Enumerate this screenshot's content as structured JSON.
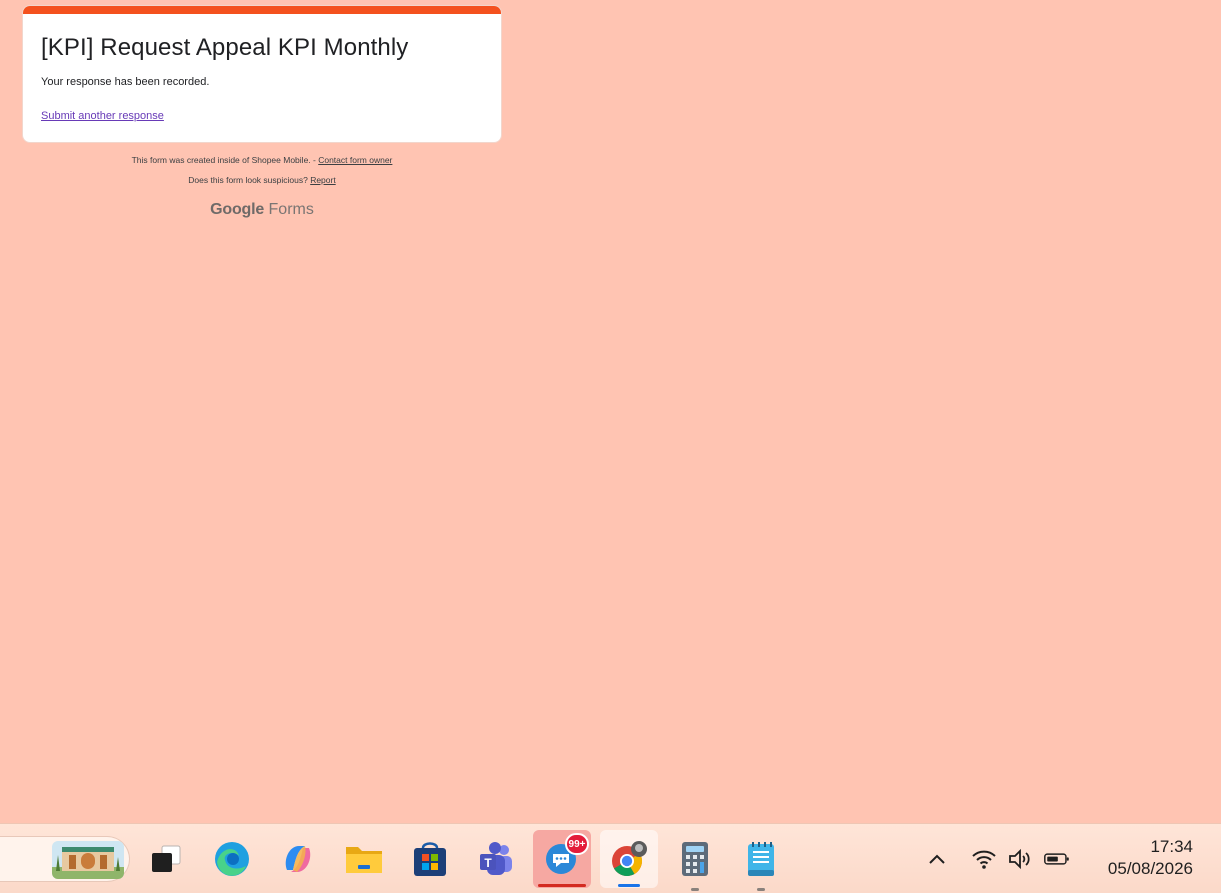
{
  "form": {
    "title": "[KPI] Request Appeal KPI Monthly",
    "confirmation": "Your response has been recorded.",
    "submit_another": "Submit another response",
    "accent_color": "#f4511e"
  },
  "footer": {
    "created_text": "This form was created inside of Shopee Mobile. - ",
    "contact_link": "Contact form owner",
    "suspicious_text": "Does this form look suspicious? ",
    "report_link": "Report",
    "logo_google": "Google",
    "logo_forms": "Forms"
  },
  "taskbar": {
    "apps": [
      {
        "name": "task-view",
        "icon": "task-view-icon"
      },
      {
        "name": "edge",
        "icon": "edge-icon"
      },
      {
        "name": "copilot",
        "icon": "copilot-icon"
      },
      {
        "name": "file-explorer",
        "icon": "folder-icon"
      },
      {
        "name": "microsoft-store",
        "icon": "store-icon"
      },
      {
        "name": "teams",
        "icon": "teams-icon"
      },
      {
        "name": "messenger",
        "icon": "chat-icon",
        "badge": "99+"
      },
      {
        "name": "chrome",
        "icon": "chrome-icon"
      },
      {
        "name": "calculator",
        "icon": "calculator-icon"
      },
      {
        "name": "notepad",
        "icon": "notepad-icon"
      }
    ],
    "clock": {
      "time": "17:34",
      "date": "05/08/2026"
    },
    "background_color": "#ffc4b2"
  }
}
